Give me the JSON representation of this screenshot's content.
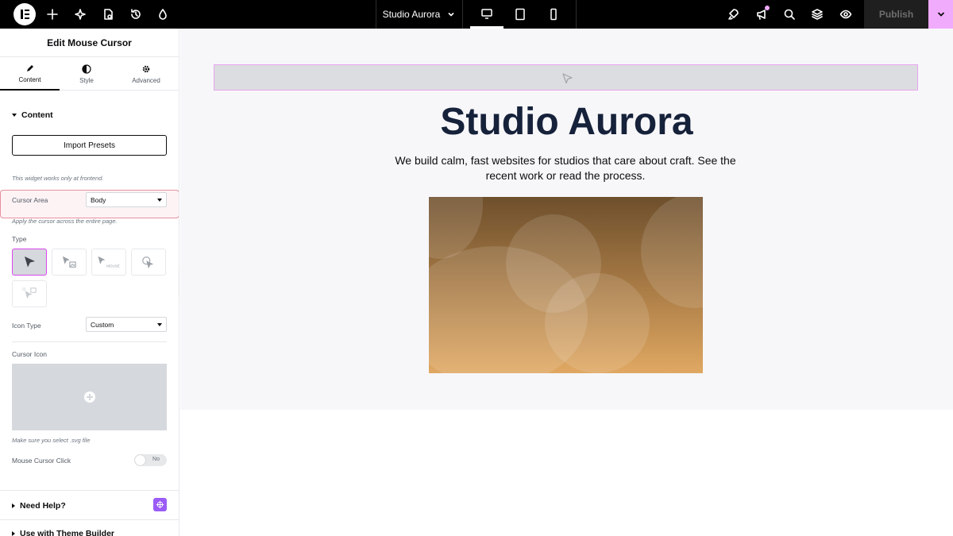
{
  "topbar": {
    "site_title": "Studio Aurora",
    "publish_label": "Publish"
  },
  "panel": {
    "title": "Edit Mouse Cursor",
    "tabs": [
      {
        "label": "Content",
        "icon": "pencil-icon"
      },
      {
        "label": "Style",
        "icon": "half-circle-icon"
      },
      {
        "label": "Advanced",
        "icon": "gear-icon"
      }
    ],
    "content_section": {
      "title": "Content",
      "import_button": "Import Presets",
      "frontend_note": "This widget works only at frontend.",
      "cursor_area": {
        "label": "Cursor Area",
        "value": "Body",
        "help": "Apply the cursor across the entire page."
      },
      "type_label": "Type",
      "type_options": [
        "arrow-cursor-icon",
        "cursor-image-icon",
        "cursor-text-icon",
        "cursor-circle-icon",
        "cursor-image-alt-icon"
      ],
      "type_mouse_badge": "MOUSE",
      "icon_type": {
        "label": "Icon Type",
        "value": "Custom"
      },
      "cursor_icon_label": "Cursor Icon",
      "svg_note": "Make sure you select .svg file",
      "click_toggle": {
        "label": "Mouse Cursor Click",
        "state": "No"
      }
    },
    "need_help": "Need Help?",
    "theme_builder": "Use with Theme Builder"
  },
  "canvas": {
    "heading": "Studio Aurora",
    "subtext": "We build calm, fast websites for studios that care about craft. See the recent work or read the process."
  },
  "colors": {
    "accent": "#d946ef",
    "publish_dropdown": "#f0abfc",
    "heading": "#16213a",
    "ai_badge": "#9b5cf6"
  }
}
